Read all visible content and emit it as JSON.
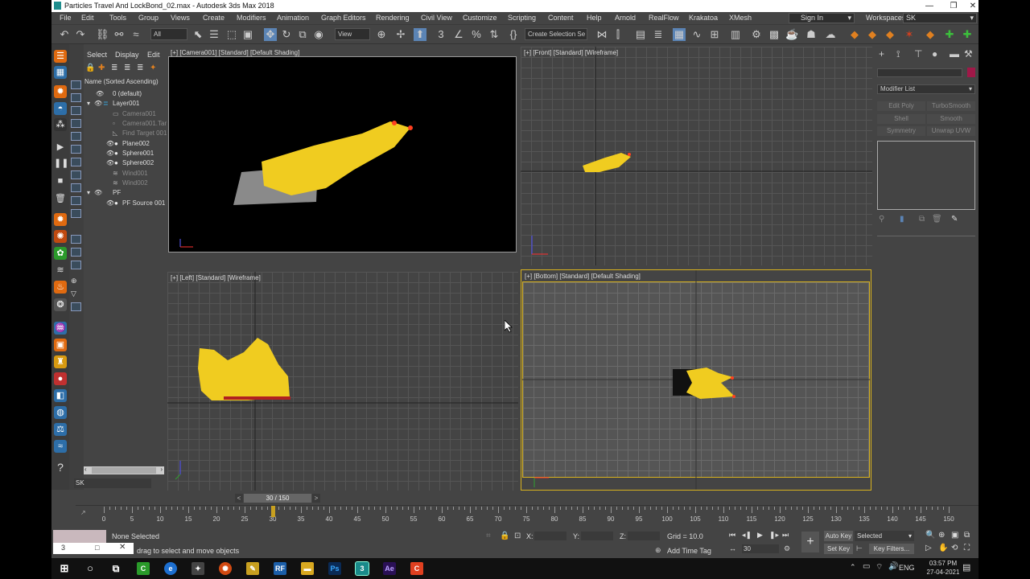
{
  "window": {
    "title": "Particles Travel And LockBond_02.max - Autodesk 3ds Max 2018",
    "minimize": "—",
    "maximize": "❐",
    "close": "✕"
  },
  "menu": {
    "items": [
      "File",
      "Edit",
      "Tools",
      "Group",
      "Views",
      "Create",
      "Modifiers",
      "Animation",
      "Graph Editors",
      "Rendering",
      "Civil View",
      "Customize",
      "Scripting",
      "Content",
      "Help",
      "Arnold",
      "RealFlow",
      "Krakatoa",
      "XMesh"
    ],
    "sign_in": "Sign In",
    "workspaces_label": "Workspaces:",
    "workspace": "SK"
  },
  "toolbar": {
    "filter": "All",
    "ref_coord": "View",
    "create_selection_set": "Create Selection Se"
  },
  "scene_explorer": {
    "tabs": [
      "Select",
      "Display",
      "Edit"
    ],
    "header": "Name (Sorted Ascending)",
    "rows": [
      {
        "label": "0 (default)",
        "dim": false
      },
      {
        "label": "Layer001",
        "dim": false
      },
      {
        "label": "Camera001",
        "dim": true
      },
      {
        "label": "Camera001.Tar",
        "dim": true
      },
      {
        "label": "Find Target 001",
        "dim": true
      },
      {
        "label": "Plane002",
        "dim": false
      },
      {
        "label": "Sphere001",
        "dim": false
      },
      {
        "label": "Sphere002",
        "dim": false
      },
      {
        "label": "Wind001",
        "dim": true
      },
      {
        "label": "Wind002",
        "dim": true
      },
      {
        "label": "PF",
        "dim": false
      },
      {
        "label": "PF Source 001",
        "dim": false
      }
    ],
    "workspace_tag": "SK"
  },
  "viewports": {
    "camera": "[+] [Camera001] [Standard] [Default Shading]",
    "front": "[+] [Front] [Standard] [Wireframe]",
    "left": "[+] [Left] [Standard] [Wireframe]",
    "bottom": "[+] [Bottom] [Standard] [Default Shading]"
  },
  "command_panel": {
    "modifier_list": "Modifier List",
    "buttons": [
      "Edit Poly",
      "TurboSmooth",
      "Shell",
      "Smooth",
      "Symmetry",
      "Unwrap UVW"
    ]
  },
  "time_slider": {
    "value": "30 / 150",
    "current_frame": 30,
    "total_frames": 150,
    "prev": "<",
    "next": ">"
  },
  "trackbar": {
    "ticks": [
      0,
      5,
      10,
      15,
      20,
      25,
      30,
      35,
      40,
      45,
      50,
      55,
      60,
      65,
      70,
      75,
      80,
      85,
      90,
      95,
      100,
      105,
      110,
      115,
      120,
      125,
      130,
      135,
      140,
      145,
      150
    ]
  },
  "status": {
    "selection": "None Selected",
    "prompt": "drag to select and move objects",
    "x_label": "X:",
    "y_label": "Y:",
    "z_label": "Z:",
    "grid": "Grid = 10.0",
    "add_time_tag": "Add Time Tag",
    "auto_key": "Auto Key",
    "set_key": "Set Key",
    "selected": "Selected",
    "key_filters": "Key Filters...",
    "frame_field": "30"
  },
  "taskbar": {
    "language": "ENG",
    "time": "03:57 PM",
    "date": "27-04-2021"
  },
  "colors": {
    "particles": "#f0cc20",
    "viewport_active_border": "#d8b21f",
    "accent_blue": "#2e7fc2"
  }
}
